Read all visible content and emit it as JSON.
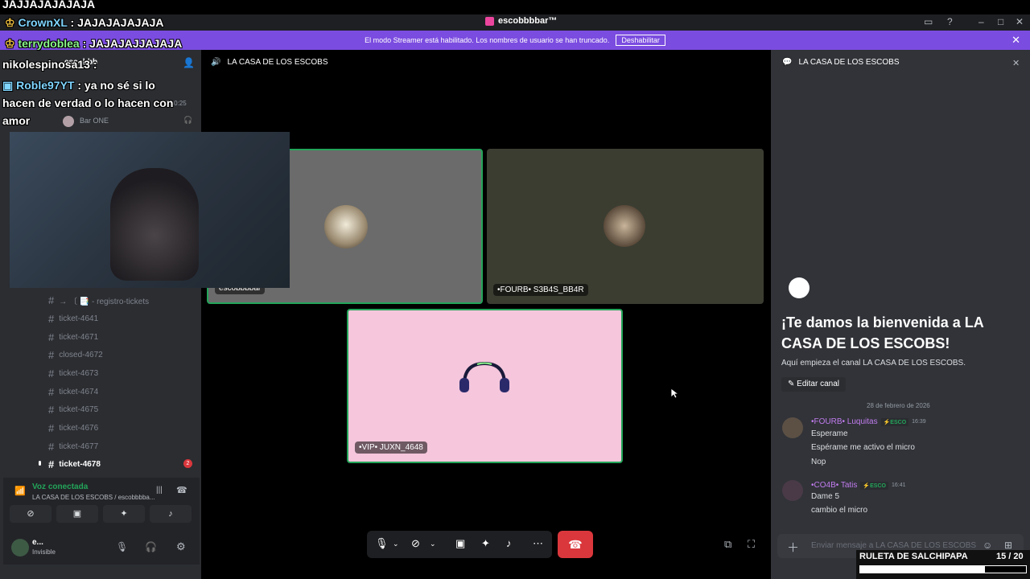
{
  "overlay_chat": [
    {
      "name": "",
      "text": "JAJJAJAJAJAJA"
    },
    {
      "name": "CrownXL",
      "text": " : JAJAJAJAJAJA"
    },
    {
      "name": "terrydoblea",
      "text": " : JAJAJAJJAJAJA"
    },
    {
      "name": "nikolespinosa13",
      "text": " : "
    },
    {
      "name": "Roble97YT",
      "text": " : ya no sé si lo"
    },
    {
      "name": "",
      "text": "hacen de verdad o lo hacen con"
    },
    {
      "name": "",
      "text": "amor"
    }
  ],
  "titlebar": {
    "title": "escobbbbar™"
  },
  "banner": {
    "text": "El modo Streamer está habilitado. Los nombres de usuario se han truncado.",
    "button": "Deshabilitar"
  },
  "sidebar": {
    "server_name": "escobbb",
    "bar_one": "Bar ONE",
    "time": "3:40:25",
    "channels": [
      {
        "name": "→ 〔 📑 - registro-tickets",
        "active": false
      },
      {
        "name": "ticket-4641",
        "active": false
      },
      {
        "name": "ticket-4671",
        "active": false
      },
      {
        "name": "closed-4672",
        "active": false
      },
      {
        "name": "ticket-4673",
        "active": false
      },
      {
        "name": "ticket-4674",
        "active": false
      },
      {
        "name": "ticket-4675",
        "active": false
      },
      {
        "name": "ticket-4676",
        "active": false
      },
      {
        "name": "ticket-4677",
        "active": false
      },
      {
        "name": "ticket-4678",
        "active": true
      }
    ],
    "unread_badge": "2",
    "voice": {
      "status": "Voz conectada",
      "channel": "LA CASA DE LOS ESCOBS / escobbbba..."
    },
    "user": {
      "name": "e...",
      "status": "Invisible"
    }
  },
  "main": {
    "title": "LA CASA DE LOS ESCOBS",
    "tiles": [
      {
        "name": "escobbbbar"
      },
      {
        "name": "•FOURB• S3B4S_BB4R"
      },
      {
        "name": "•VIP• JUXN_4648"
      }
    ]
  },
  "chat": {
    "title": "LA CASA DE LOS ESCOBS",
    "welcome_title": "¡Te damos la bienvenida a LA CASA DE LOS ESCOBS!",
    "welcome_sub": "Aquí empieza el canal LA CASA DE LOS ESCOBS.",
    "edit_button": "Editar canal",
    "date": "28 de febrero de 2026",
    "messages": [
      {
        "user": "•FOURB• Luquitas",
        "tag": "⚡ESCO",
        "time": "16:39",
        "lines": [
          "Esperame",
          "Espérame me activo el micro",
          "Nop"
        ]
      },
      {
        "user": "•CO4B• Tatis",
        "tag": "⚡ESCO",
        "time": "16:41",
        "lines": [
          "Dame 5",
          "cambio el micro"
        ]
      }
    ],
    "input_placeholder": "Enviar mensaje a LA CASA DE LOS ESCOBS"
  },
  "ruleta": {
    "label": "RULETA DE SALCHIPAPA",
    "count": "15  / 20",
    "progress": 0.75
  },
  "colors": {
    "accent": "#7b4ce0",
    "hangup": "#da373c",
    "tile_pink": "#f5c6dc",
    "tile_gray": "#6b6b6b",
    "tile_olive": "#3b3d31",
    "online": "#23a55a"
  }
}
